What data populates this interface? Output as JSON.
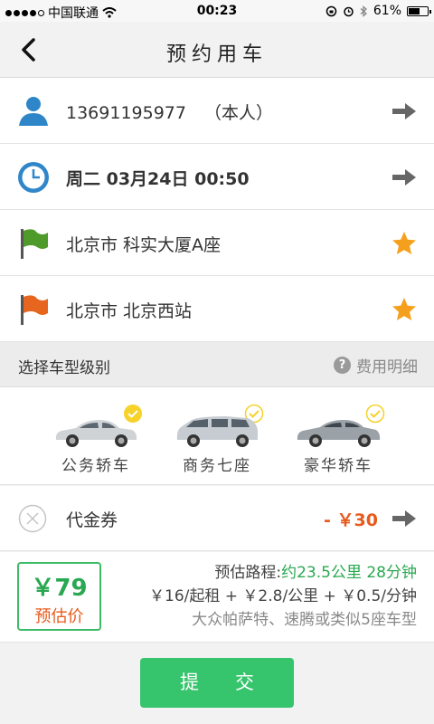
{
  "status_bar": {
    "carrier": "中国联通",
    "time": "00:23",
    "battery": "61%",
    "battery_level": 0.61
  },
  "header": {
    "title": "预约用车",
    "back_icon": "chevron-left-icon"
  },
  "passenger": {
    "phone": "13691195977",
    "note": "（本人）",
    "icon": "person-icon"
  },
  "schedule": {
    "text": "周二 03月24日 00:50",
    "icon": "clock-icon"
  },
  "start_location": {
    "text": "北京市 科实大厦A座",
    "icon": "green-flag-icon"
  },
  "destination": {
    "text": "北京市 北京西站",
    "icon": "orange-flag-icon"
  },
  "vehicle_section": {
    "label": "选择车型级别",
    "detail_link": "费用明细",
    "detail_icon_glyph": "?"
  },
  "car_types": [
    {
      "name": "公务轿车",
      "color": "#cfd3d6"
    },
    {
      "name": "商务七座",
      "color": "#c6ccd1"
    },
    {
      "name": "豪华轿车",
      "color": "#9aa1a7"
    }
  ],
  "coupon": {
    "label": "代金券",
    "amount": "- ￥30"
  },
  "estimate": {
    "price": "￥79",
    "price_label": "预估价",
    "route_prefix": "预估路程:",
    "route_value": "约23.5公里 28分钟",
    "pricing_rule": "￥16/起租 + ￥2.8/公里 + ￥0.5/分钟",
    "models": "大众帕萨特、速腾或类似5座车型"
  },
  "submit_label": "提交",
  "colors": {
    "accent_green": "#36c46c",
    "accent_orange": "#e8591c"
  }
}
